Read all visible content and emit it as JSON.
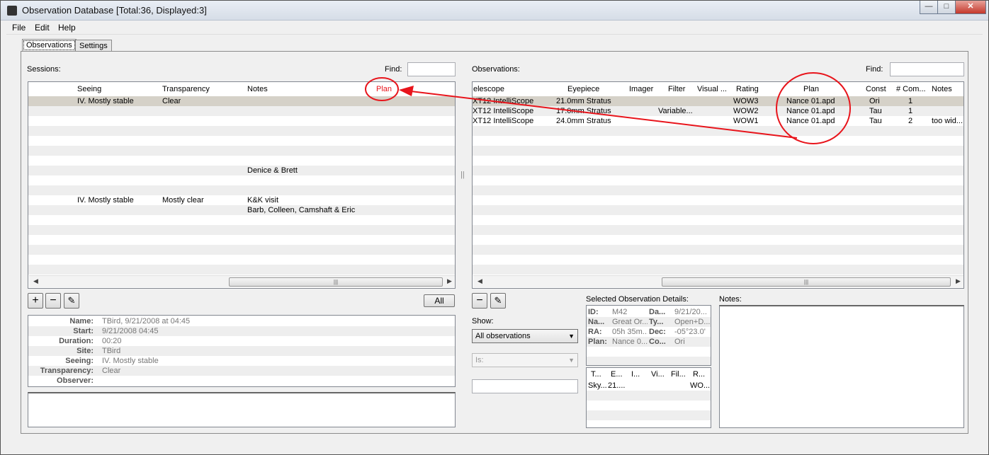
{
  "window": {
    "title": "Observation Database [Total:36, Displayed:3]",
    "minimize": "—",
    "maximize": "□",
    "close": "✕"
  },
  "menu": {
    "items": [
      "File",
      "Edit",
      "Help"
    ]
  },
  "tabs": [
    {
      "label": "Observations",
      "active": true
    },
    {
      "label": "Settings",
      "active": false
    }
  ],
  "sessions": {
    "label": "Sessions:",
    "find_label": "Find:",
    "columns": [
      "Seeing",
      "Transparency",
      "Notes",
      "Plan"
    ],
    "rows": [
      {
        "seeing": "IV. Mostly stable",
        "transparency": "Clear",
        "notes": "",
        "plan": ""
      },
      {
        "seeing": "",
        "transparency": "",
        "notes": "",
        "plan": ""
      },
      {
        "seeing": "",
        "transparency": "",
        "notes": "",
        "plan": ""
      },
      {
        "seeing": "",
        "transparency": "",
        "notes": "",
        "plan": ""
      },
      {
        "seeing": "",
        "transparency": "",
        "notes": "",
        "plan": ""
      },
      {
        "seeing": "",
        "transparency": "",
        "notes": "",
        "plan": ""
      },
      {
        "seeing": "",
        "transparency": "",
        "notes": "",
        "plan": ""
      },
      {
        "seeing": "",
        "transparency": "",
        "notes": "Denice & Brett",
        "plan": ""
      },
      {
        "seeing": "",
        "transparency": "",
        "notes": "",
        "plan": ""
      },
      {
        "seeing": "",
        "transparency": "",
        "notes": "",
        "plan": ""
      },
      {
        "seeing": "IV. Mostly stable",
        "transparency": "Mostly clear",
        "notes": "K&K visit",
        "plan": ""
      },
      {
        "seeing": "",
        "transparency": "",
        "notes": "Barb, Colleen, Camshaft & Eric",
        "plan": ""
      },
      {
        "seeing": "",
        "transparency": "",
        "notes": "",
        "plan": ""
      },
      {
        "seeing": "",
        "transparency": "",
        "notes": "",
        "plan": ""
      },
      {
        "seeing": "",
        "transparency": "",
        "notes": "",
        "plan": ""
      },
      {
        "seeing": "",
        "transparency": "",
        "notes": "",
        "plan": ""
      },
      {
        "seeing": "",
        "transparency": "",
        "notes": "",
        "plan": ""
      },
      {
        "seeing": "",
        "transparency": "",
        "notes": "",
        "plan": ""
      }
    ],
    "buttons": {
      "add": "+",
      "remove": "−",
      "edit": "✎",
      "all": "All"
    },
    "details": [
      {
        "key": "Name:",
        "value": "TBird, 9/21/2008 at 04:45"
      },
      {
        "key": "Start:",
        "value": "9/21/2008 04:45"
      },
      {
        "key": "Duration:",
        "value": "00:20"
      },
      {
        "key": "Site:",
        "value": "TBird"
      },
      {
        "key": "Seeing:",
        "value": "IV. Mostly stable"
      },
      {
        "key": "Transparency:",
        "value": "Clear"
      },
      {
        "key": "Observer:",
        "value": ""
      }
    ]
  },
  "observations": {
    "label": "Observations:",
    "find_label": "Find:",
    "columns": [
      "elescope",
      "Eyepiece",
      "Imager",
      "Filter",
      "Visual ...",
      "Rating",
      "Plan",
      "Const",
      "# Com...",
      "Notes"
    ],
    "rows": [
      {
        "telescope": "XT12 IntelliScope",
        "eyepiece": "21.0mm Stratus",
        "imager": "",
        "filter": "",
        "visual": "",
        "rating": "WOW3",
        "plan": "Nance 01.apd",
        "const": "Ori",
        "comments": "1",
        "notes": ""
      },
      {
        "telescope": "XT12 IntelliScope",
        "eyepiece": "17.0mm Stratus",
        "imager": "",
        "filter": "Variable...",
        "visual": "",
        "rating": "WOW2",
        "plan": "Nance 01.apd",
        "const": "Tau",
        "comments": "1",
        "notes": ""
      },
      {
        "telescope": "XT12 IntelliScope",
        "eyepiece": "24.0mm Stratus",
        "imager": "",
        "filter": "",
        "visual": "",
        "rating": "WOW1",
        "plan": "Nance 01.apd",
        "const": "Tau",
        "comments": "2",
        "notes": "too wid..."
      }
    ],
    "buttons": {
      "remove": "−",
      "edit": "✎"
    },
    "show_label": "Show:",
    "show_value": "All observations",
    "is_value": "Is:",
    "selected_label": "Selected Observation Details:",
    "selected_details": [
      {
        "k1": "ID:",
        "v1": "M42",
        "k2": "Da...",
        "v2": "9/21/20..."
      },
      {
        "k1": "Na...",
        "v1": "Great Or...",
        "k2": "Ty...",
        "v2": "Open+D..."
      },
      {
        "k1": "RA:",
        "v1": "05h 35m...",
        "k2": "Dec:",
        "v2": "-05°23.0'"
      },
      {
        "k1": "Plan:",
        "v1": "Nance 0...",
        "k2": "Co...",
        "v2": "Ori"
      }
    ],
    "sub_columns": [
      "T...",
      "E...",
      "I...",
      "Vi...",
      "Fil...",
      "R..."
    ],
    "sub_row": {
      "t": "Sky...",
      "e": "21....",
      "r": "WO..."
    },
    "notes_label": "Notes:"
  },
  "splitter": "||",
  "colors": {
    "annotation": "#e8141b",
    "selected_row": "#d5d1c8",
    "alt_row": "#eeeeee"
  }
}
